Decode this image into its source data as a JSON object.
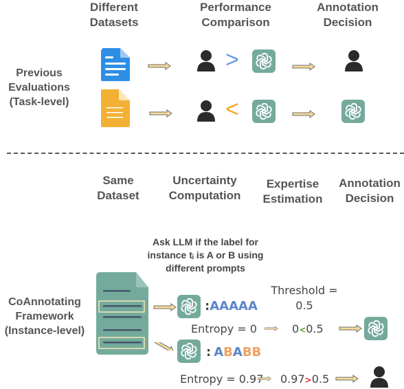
{
  "top": {
    "columns": [
      {
        "line1": "Different",
        "line2": "Datasets"
      },
      {
        "line1": "Performance",
        "line2": "Comparison"
      },
      {
        "line1": "Annotation",
        "line2": "Decision"
      }
    ],
    "row_label": {
      "line1": "Previous",
      "line2": "Evaluations",
      "line3": "(Task-level)"
    },
    "rows": [
      {
        "dataset_icon": "document-blue-icon",
        "comparator": ">",
        "comparator_color": "#6a9be8",
        "decision": "human"
      },
      {
        "dataset_icon": "document-orange-icon",
        "comparator": "<",
        "comparator_color": "#f5a623",
        "decision": "llm"
      }
    ]
  },
  "bottom": {
    "columns": [
      {
        "line1": "Same",
        "line2": "Dataset"
      },
      {
        "line1": "Uncertainty",
        "line2": "Computation"
      },
      {
        "line1": "Expertise",
        "line2": "Estimation"
      },
      {
        "line1": "Annotation",
        "line2": "Decision"
      }
    ],
    "row_label": {
      "line1": "CoAnnotating",
      "line2": "Framework",
      "line3": "(Instance-level)"
    },
    "prompt": {
      "line1": "Ask LLM if the label for",
      "line2": "instance tᵢ is A or B using",
      "line3": "different prompts"
    },
    "threshold": {
      "line1": "Threshold =",
      "line2": "0.5"
    },
    "case1": {
      "sequence": [
        {
          "c": "A",
          "color": "#5b84c9"
        },
        {
          "c": "A",
          "color": "#5b84c9"
        },
        {
          "c": "A",
          "color": "#5b84c9"
        },
        {
          "c": "A",
          "color": "#5b84c9"
        },
        {
          "c": "A",
          "color": "#5b84c9"
        }
      ],
      "prefix": ":",
      "entropy_label": "Entropy = 0",
      "cmp_left": "0",
      "cmp_op": "<",
      "cmp_op_color": "#5a9a2a",
      "cmp_right": "0.5",
      "decision": "llm"
    },
    "case2": {
      "sequence": [
        {
          "c": "A",
          "color": "#5b84c9"
        },
        {
          "c": "B",
          "color": "#f0a060"
        },
        {
          "c": "A",
          "color": "#5b84c9"
        },
        {
          "c": "B",
          "color": "#f0a060"
        },
        {
          "c": "B",
          "color": "#f0a060"
        }
      ],
      "prefix": ":",
      "entropy_label": "Entropy = 0.97",
      "cmp_left": "0.97",
      "cmp_op": ">",
      "cmp_op_color": "#e02020",
      "cmp_right": "0.5",
      "decision": "human"
    }
  },
  "colors": {
    "llm_bg": "#74aa9c",
    "person": "#2b2b2b",
    "arrow_fill": "#f5dc98",
    "arrow_stroke": "#6b6b6b",
    "doc_blue": "#2e8ee6",
    "doc_orange": "#f2b135",
    "doc_green": "#74aa9c"
  }
}
